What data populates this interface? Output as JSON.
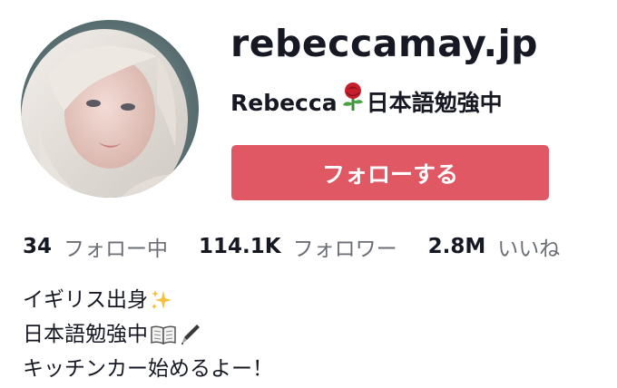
{
  "profile": {
    "username": "rebeccamay.jp",
    "display_name_prefix": "Rebecca",
    "display_name_suffix": "日本語勉強中",
    "display_name_emoji": "rose",
    "follow_label": "フォローする"
  },
  "stats": [
    {
      "value": "34",
      "label": "フォロー中"
    },
    {
      "value": "114.1K",
      "label": "フォロワー"
    },
    {
      "value": "2.8M",
      "label": "いいね"
    }
  ],
  "bio": {
    "line1": "イギリス出身",
    "line1_emoji": "sparkles",
    "line2": "日本語勉強中",
    "line2_emojis": [
      "open-book",
      "fountain-pen"
    ],
    "line3": "キッチンカー始めるよー！"
  },
  "colors": {
    "follow_button": "#e05863",
    "text_primary": "#161823",
    "text_secondary": "#6b6e76"
  }
}
